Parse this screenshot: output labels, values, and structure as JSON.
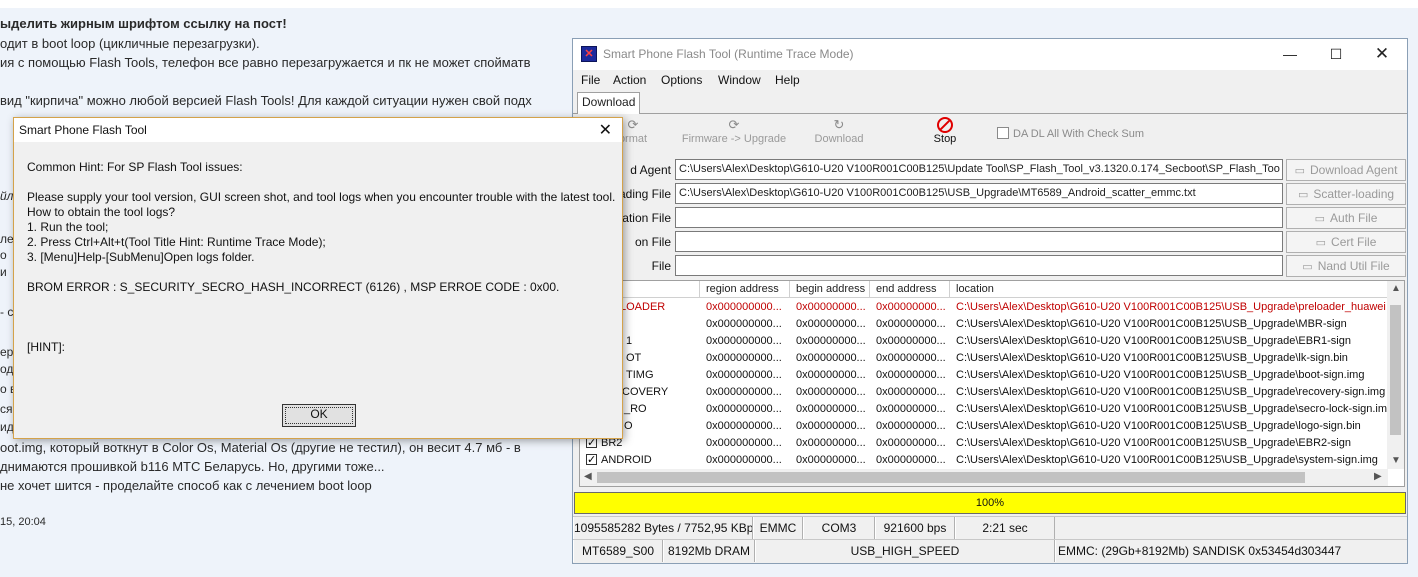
{
  "background_page": {
    "lines": [
      "ыделить жирным шрифтом ссылку на пост!",
      "одит в boot loop (цикличные перезагрузки).",
      "ия с помощью Flash Tools, телефон все равно перезагружается и пк не может спойматв",
      "вид \"кирпича\" можно любой версией Flash Tools! Для каждой ситуации нужен свой подх",
      "oot.img, который воткнут в Color Os, Material Os (другие не тестил), он весит 4.7 мб - в",
      "днимаются прошивкой b116 МТС Беларусь. Но, другими тоже...",
      "не хочет шится - проделайте способ как с лечением boot loop",
      "15, 20:04"
    ],
    "fragments": [
      "йл",
      "ле",
      "о",
      "и",
      "- с",
      "ер",
      "одс",
      "о в",
      "ся",
      "ид"
    ]
  },
  "window": {
    "title": "Smart Phone Flash Tool (Runtime Trace Mode)",
    "menu": [
      "File",
      "Action",
      "Options",
      "Window",
      "Help"
    ],
    "tab": "Download",
    "toolbar": {
      "format": "ormat",
      "firmware_upgrade": "Firmware -> Upgrade",
      "download": "Download",
      "stop": "Stop",
      "da_checksum": "DA DL All With Check Sum"
    },
    "file_rows": [
      {
        "label": "d Agent",
        "value": "C:\\Users\\Alex\\Desktop\\G610-U20 V100R001C00B125\\Update Tool\\SP_Flash_Tool_v3.1320.0.174_Secboot\\SP_Flash_Too",
        "button": "Download Agent"
      },
      {
        "label": "ading File",
        "value": "C:\\Users\\Alex\\Desktop\\G610-U20 V100R001C00B125\\USB_Upgrade\\MT6589_Android_scatter_emmc.txt",
        "button": "Scatter-loading"
      },
      {
        "label": "ation File",
        "value": "",
        "button": "Auth File"
      },
      {
        "label": "on File",
        "value": "",
        "button": "Cert File"
      },
      {
        "label": "File",
        "value": "",
        "button": "Nand Util File"
      }
    ],
    "table": {
      "columns": [
        "region address",
        "begin address",
        "end address",
        "location"
      ],
      "rows": [
        {
          "name": "LOADER",
          "checked": false,
          "region": "0x000000000...",
          "begin": "0x00000000...",
          "end": "0x00000000...",
          "location": "C:\\Users\\Alex\\Desktop\\G610-U20 V100R001C00B125\\USB_Upgrade\\preloader_huawei",
          "highlight": true
        },
        {
          "name": "",
          "checked": false,
          "region": "0x000000000...",
          "begin": "0x00000000...",
          "end": "0x00000000...",
          "location": "C:\\Users\\Alex\\Desktop\\G610-U20 V100R001C00B125\\USB_Upgrade\\MBR-sign"
        },
        {
          "name": "1",
          "checked": false,
          "region": "0x000000000...",
          "begin": "0x00000000...",
          "end": "0x00000000...",
          "location": "C:\\Users\\Alex\\Desktop\\G610-U20 V100R001C00B125\\USB_Upgrade\\EBR1-sign"
        },
        {
          "name": "OT",
          "checked": false,
          "region": "0x000000000...",
          "begin": "0x00000000...",
          "end": "0x00000000...",
          "location": "C:\\Users\\Alex\\Desktop\\G610-U20 V100R001C00B125\\USB_Upgrade\\lk-sign.bin"
        },
        {
          "name": "TIMG",
          "checked": false,
          "region": "0x000000000...",
          "begin": "0x00000000...",
          "end": "0x00000000...",
          "location": "C:\\Users\\Alex\\Desktop\\G610-U20 V100R001C00B125\\USB_Upgrade\\boot-sign.img"
        },
        {
          "name": "COVERY",
          "checked": false,
          "region": "0x000000000...",
          "begin": "0x00000000...",
          "end": "0x00000000...",
          "location": "C:\\Users\\Alex\\Desktop\\G610-U20 V100R001C00B125\\USB_Upgrade\\recovery-sign.img"
        },
        {
          "name": "_RO",
          "checked": false,
          "region": "0x000000000...",
          "begin": "0x00000000...",
          "end": "0x00000000...",
          "location": "C:\\Users\\Alex\\Desktop\\G610-U20 V100R001C00B125\\USB_Upgrade\\secro-lock-sign.im"
        },
        {
          "name": "O",
          "checked": false,
          "region": "0x000000000...",
          "begin": "0x00000000...",
          "end": "0x00000000...",
          "location": "C:\\Users\\Alex\\Desktop\\G610-U20 V100R001C00B125\\USB_Upgrade\\logo-sign.bin"
        },
        {
          "name": "BR2",
          "checked": true,
          "region": "0x000000000...",
          "begin": "0x00000000...",
          "end": "0x00000000...",
          "location": "C:\\Users\\Alex\\Desktop\\G610-U20 V100R001C00B125\\USB_Upgrade\\EBR2-sign"
        },
        {
          "name": "ANDROID",
          "checked": true,
          "region": "0x000000000...",
          "begin": "0x00000000...",
          "end": "0x00000000...",
          "location": "C:\\Users\\Alex\\Desktop\\G610-U20 V100R001C00B125\\USB_Upgrade\\system-sign.img"
        }
      ]
    },
    "progress": {
      "text": "100%",
      "value": 1.0,
      "color": "#ffff00"
    },
    "status1": [
      "1095585282 Bytes / 7752,95 KBps",
      "EMMC",
      "COM3",
      "921600 bps",
      "2:21 sec"
    ],
    "status2": [
      "MT6589_S00",
      "8192Mb DRAM",
      "USB_HIGH_SPEED",
      "EMMC: (29Gb+8192Mb) SANDISK 0x53454d303447"
    ]
  },
  "dialog": {
    "title": "Smart Phone Flash Tool",
    "hint_title": "Common Hint: For SP Flash Tool issues:",
    "line1": "Please supply your tool version, GUI screen shot, and tool logs when you encounter trouble with the latest tool.",
    "line2": "How to obtain the tool logs?",
    "step1": "1. Run the tool;",
    "step2": "2. Press Ctrl+Alt+t(Tool Title Hint: Runtime Trace Mode);",
    "step3": "3. [Menu]Help-[SubMenu]Open logs folder.",
    "error": "BROM ERROR : S_SECURITY_SECRO_HASH_INCORRECT (6126) , MSP ERROE CODE : 0x00.",
    "hint": "[HINT]:",
    "ok": "OK"
  },
  "colors": {
    "highlight_row": "#c00000",
    "stop_icon": "#e00000",
    "dialog_border": "#d4a24a"
  },
  "icons": [
    "app-icon",
    "minimize-icon",
    "maximize-icon",
    "close-icon",
    "format-icon",
    "firmware-upgrade-icon",
    "download-icon",
    "stop-icon"
  ]
}
